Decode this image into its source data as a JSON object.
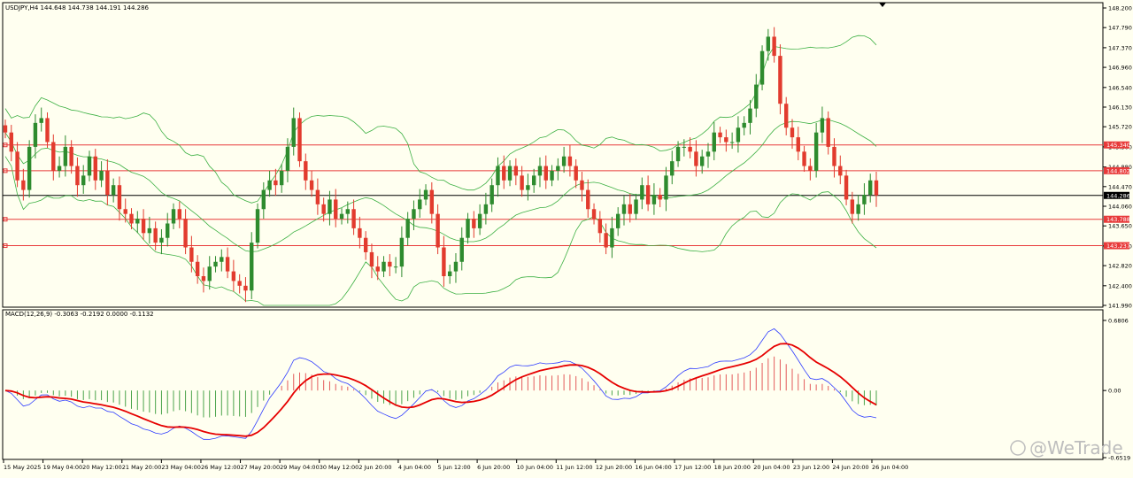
{
  "colors": {
    "background": "#fffff0",
    "bull": "#2e8b2e",
    "bear": "#e23b2e",
    "bands": "#3cb043",
    "level": "#e83a3a",
    "price_line": "#000000",
    "macd_line": "#2e3cff",
    "signal_line": "#e60000",
    "hist_up": "#e35a5a",
    "hist_down": "#4aa34a"
  },
  "chart_data": [
    {
      "type": "candlestick",
      "title": "USDJPY,H4  144.648 144.738 144.191 144.286",
      "symbol": "USDJPY,H4",
      "ohlc_label": "144.648 144.738 144.191 144.286",
      "current_price": "144.286",
      "ylim": [
        141.99,
        148.2
      ],
      "y_ticks": [
        "148.200",
        "147.790",
        "147.370",
        "146.960",
        "146.540",
        "146.130",
        "145.720",
        "145.300",
        "144.880",
        "144.470",
        "144.060",
        "143.650",
        "143.230",
        "142.820",
        "142.400",
        "141.990"
      ],
      "levels": [
        {
          "label": "145.340",
          "value": 145.34
        },
        {
          "label": "144.802",
          "value": 144.802
        },
        {
          "label": "143.788",
          "value": 143.788
        },
        {
          "label": "143.237",
          "value": 143.237
        }
      ],
      "x_ticks": [
        "15 May 2025",
        "19 May 04:00",
        "20 May 12:00",
        "21 May 20:00",
        "23 May 04:00",
        "26 May 12:00",
        "27 May 20:00",
        "29 May 04:00",
        "30 May 12:00",
        "2 Jun 20:00",
        "4 Jun 04:00",
        "5 Jun 12:00",
        "6 Jun 20:00",
        "10 Jun 04:00",
        "11 Jun 12:00",
        "12 Jun 20:00",
        "16 Jun 04:00",
        "17 Jun 12:00",
        "18 Jun 20:00",
        "20 Jun 04:00",
        "23 Jun 12:00",
        "24 Jun 20:00",
        "26 Jun 04:00"
      ],
      "close_path": [
        145.6,
        145.2,
        144.6,
        144.4,
        145.3,
        145.8,
        145.9,
        145.4,
        144.8,
        144.9,
        145.3,
        144.9,
        144.5,
        144.7,
        145.1,
        144.6,
        144.8,
        144.3,
        144.5,
        144.0,
        143.9,
        143.7,
        143.8,
        143.5,
        143.6,
        143.3,
        143.4,
        143.7,
        144.0,
        143.8,
        143.2,
        142.9,
        142.6,
        142.5,
        142.8,
        142.9,
        143.0,
        142.7,
        142.5,
        142.4,
        142.3,
        143.3,
        144.0,
        144.4,
        144.6,
        144.5,
        144.8,
        145.3,
        145.9,
        145.0,
        144.6,
        144.4,
        144.1,
        143.9,
        144.2,
        143.8,
        143.9,
        144.0,
        143.6,
        143.4,
        143.1,
        142.8,
        142.7,
        142.9,
        142.8,
        142.8,
        143.4,
        143.8,
        144.0,
        144.2,
        144.4,
        143.9,
        143.2,
        142.6,
        142.7,
        142.9,
        143.4,
        143.8,
        143.6,
        143.9,
        144.1,
        144.5,
        144.9,
        144.6,
        144.9,
        144.7,
        144.4,
        144.5,
        144.7,
        144.9,
        144.6,
        144.8,
        144.9,
        145.1,
        144.9,
        144.6,
        144.4,
        144.0,
        143.8,
        143.5,
        143.2,
        143.6,
        143.9,
        144.1,
        143.9,
        144.2,
        144.5,
        144.1,
        144.3,
        144.2,
        144.7,
        145.0,
        145.3,
        145.3,
        145.2,
        144.9,
        145.1,
        145.2,
        145.6,
        145.5,
        145.4,
        145.4,
        145.7,
        145.8,
        146.1,
        146.6,
        147.3,
        147.6,
        147.2,
        146.2,
        145.7,
        145.5,
        145.2,
        144.9,
        144.8,
        145.6,
        145.9,
        145.3,
        144.9,
        144.7,
        144.2,
        143.9,
        144.1,
        144.3,
        144.6,
        144.286
      ],
      "bands_source": "20-period envelope"
    },
    {
      "type": "line",
      "title": "MACD(12,26,9) -0.3063 -0.2192 0.0000 -0.1132",
      "indicator_label": "MACD(12,26,9) -0.3063 -0.2192 0.0000 -0.1132",
      "ylim": [
        -0.6519,
        0.6806
      ],
      "y_ticks": [
        "0.6806",
        "0.00",
        "-0.6519"
      ],
      "series": [
        {
          "name": "MACD",
          "role": "macd"
        },
        {
          "name": "Signal",
          "role": "signal"
        },
        {
          "name": "Histogram",
          "role": "histogram"
        }
      ]
    }
  ],
  "watermark": "@WeTrade"
}
